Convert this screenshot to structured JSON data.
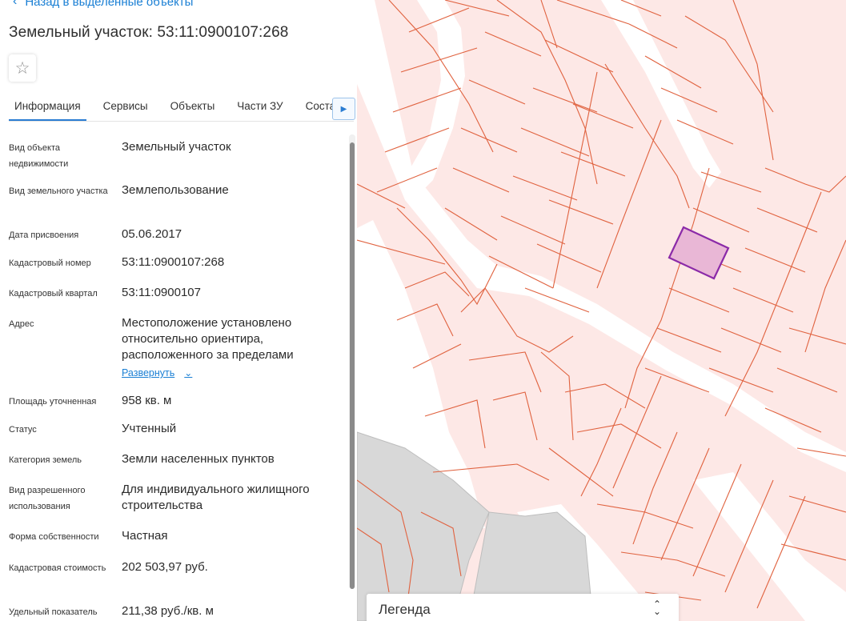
{
  "panel": {
    "back_label": "Назад в выделенные объекты",
    "title": "Земельный участок: 53:11:0900107:268",
    "tabs": [
      {
        "label": "Информация"
      },
      {
        "label": "Сервисы"
      },
      {
        "label": "Объекты"
      },
      {
        "label": "Части ЗУ"
      },
      {
        "label": "Состав"
      }
    ],
    "active_tab": "Информация",
    "fields": [
      {
        "label": "Вид объекта недвижимости",
        "value": "Земельный участок"
      },
      {
        "label": "Вид земельного участка",
        "value": "Землепользование"
      },
      {
        "label": "Дата присвоения",
        "value": "05.06.2017"
      },
      {
        "label": "Кадастровый номер",
        "value": "53:11:0900107:268"
      },
      {
        "label": "Кадастровый квартал",
        "value": "53:11:0900107"
      },
      {
        "label": "Адрес",
        "value": "Местоположение установлено относительно ориентира, расположенного за пределами"
      },
      {
        "label": "Площадь уточненная",
        "value": "958 кв. м"
      },
      {
        "label": "Статус",
        "value": "Учтенный"
      },
      {
        "label": "Категория земель",
        "value": "Земли населенных пунктов"
      },
      {
        "label": "Вид разрешенного использования",
        "value": "Для индивидуального жилищного строительства"
      },
      {
        "label": "Форма собственности",
        "value": "Частная"
      },
      {
        "label": "Кадастровая стоимость",
        "value": "202 503,97 руб."
      },
      {
        "label": "Удельный показатель",
        "value": "211,38 руб./кв. м"
      }
    ],
    "expand_label": "Развернуть"
  },
  "map": {
    "legend_label": "Легенда",
    "colors": {
      "parcel_fill": "#fde8e6",
      "parcel_border": "#e0623f",
      "road": "#ffffff",
      "building": "#d9d9d9",
      "selected_fill": "#e9b7d6",
      "selected_border": "#8b2aa8"
    }
  },
  "icons": {
    "back": "chevron-left-icon",
    "favorite": "star-outline-icon",
    "tab_scroll": "caret-right-icon",
    "expand": "chevron-down-icon",
    "legend_sort": "sort-arrows-icon"
  }
}
